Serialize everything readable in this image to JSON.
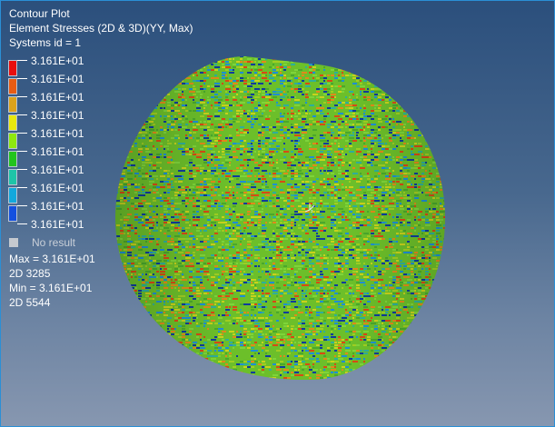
{
  "plot": {
    "title": "Contour Plot",
    "result_type": "Element Stresses (2D & 3D)(YY, Max)",
    "system": "Systems id = 1"
  },
  "legend": {
    "labels": [
      "3.161E+01",
      "3.161E+01",
      "3.161E+01",
      "3.161E+01",
      "3.161E+01",
      "3.161E+01",
      "3.161E+01",
      "3.161E+01",
      "3.161E+01",
      "3.161E+01"
    ],
    "colors": [
      "#e80e0e",
      "#e85c14",
      "#dca21c",
      "#e8e80e",
      "#8ee80e",
      "#22c41e",
      "#1ec4a8",
      "#12a8dc",
      "#1450e0",
      "#0e0eb4"
    ],
    "no_result_label": "No result",
    "no_result_color": "#c5c9cf"
  },
  "stats": {
    "max_label": "Max = 3.161E+01",
    "max_element": "2D 3285",
    "min_label": "Min = 3.161E+01",
    "min_element": "2D 5544"
  },
  "model": {
    "shape": "cylindrical shell",
    "base_color": "#6cbf2a",
    "noise_colors": [
      "#9fce22",
      "#4aa82c",
      "#c9d21c",
      "#2fae9a",
      "#1e8ed4",
      "#d84a14",
      "#103c9c",
      "#7ed43a",
      "#e08a1a"
    ]
  },
  "triad": {
    "icon": "coordinate-triad-icon"
  }
}
